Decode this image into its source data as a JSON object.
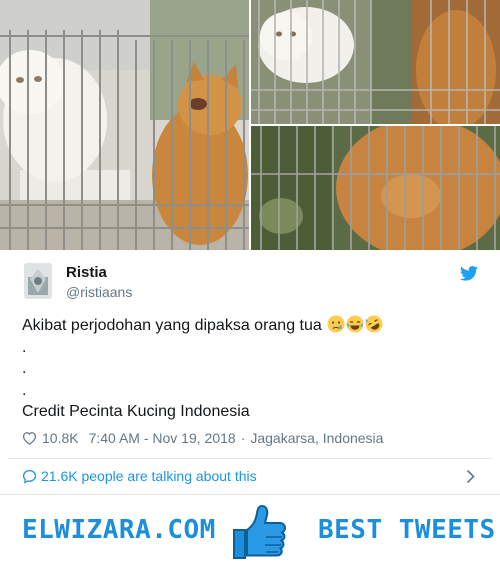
{
  "colors": {
    "accent": "#1b95e0",
    "brand": "#1b8fdc",
    "text": "#14171a",
    "secondary": "#657786",
    "divider": "#e1e8ed"
  },
  "photos": [
    {
      "name": "cats-in-cage-photo-1"
    },
    {
      "name": "white-cat-in-cage-photo-2"
    },
    {
      "name": "orange-cat-paw-photo-3"
    }
  ],
  "tweet": {
    "author_name": "Ristia",
    "author_handle": "@ristiaans",
    "text_line1": "Akibat perjodohan yang dipaksa orang tua",
    "emojis": [
      "crying-face-emoji",
      "tears-of-joy-emoji",
      "rolling-laughing-emoji"
    ],
    "dot1": ".",
    "dot2": ".",
    "dot3": ".",
    "text_credit": "Credit Pecinta Kucing Indonesia",
    "likes": "10.8K",
    "timestamp": "7:40 AM - Nov 19, 2018",
    "separator": "·",
    "location": "Jagakarsa, Indonesia",
    "talk_text": "21.6K people are talking about this"
  },
  "branding": {
    "left_text": "ELWIZARA.COM",
    "right_text": "BEST TWEETS",
    "icon": "thumbs-up-icon"
  }
}
